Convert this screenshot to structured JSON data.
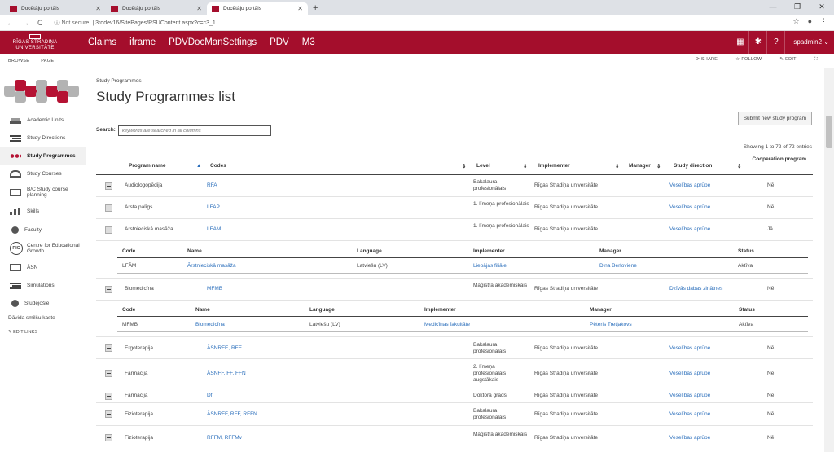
{
  "browser": {
    "tabs": [
      {
        "title": "Docētāju portāls"
      },
      {
        "title": "Docētāju portāls"
      },
      {
        "title": "Docētāju portāls"
      }
    ],
    "new_tab": "+",
    "not_secure": "Not secure",
    "url": "3rodev16/SitePages/RSUContent.aspx?c=c3_1",
    "back": "←",
    "forward": "→",
    "reload": "C",
    "info": "ⓘ",
    "minimize": "—",
    "maximize": "❐",
    "close": "✕",
    "star": "☆",
    "account": "●",
    "menu": "⋮"
  },
  "suite": {
    "logo_line1": "RĪGAS STRADIŅA",
    "logo_line2": "UNIVERSITĀTE",
    "nav": [
      "Claims",
      "iframe",
      "PDVDocManSettings",
      "PDV",
      "M3"
    ],
    "apps_icon": "▦",
    "settings_icon": "✱",
    "help_icon": "?",
    "user": "spadmin2 ⌄"
  },
  "ribbon": {
    "browse": "BROWSE",
    "page": "PAGE",
    "share": "⟳ SHARE",
    "follow": "☆ FOLLOW",
    "edit": "✎ EDIT",
    "focus": "⛶"
  },
  "sidebar": {
    "items": [
      {
        "label": "Academic Units",
        "icon": "a"
      },
      {
        "label": "Study Directions",
        "icon": "b"
      },
      {
        "label": "Study Programmes",
        "icon": "c"
      },
      {
        "label": "Study Courses",
        "icon": "d"
      },
      {
        "label": "B/C Study course planning",
        "icon": "e"
      },
      {
        "label": "Skills",
        "icon": "f"
      },
      {
        "label": "Faculty",
        "icon": "g"
      },
      {
        "label": "Centre for Educational Growth",
        "icon": "pic",
        "pic_text": "PIC"
      },
      {
        "label": "ĀSN",
        "icon": "e"
      },
      {
        "label": "Simulations",
        "icon": "b"
      },
      {
        "label": "Studējošie",
        "icon": "g"
      }
    ],
    "sandbox": "Dāvida smilšu kaste",
    "edit_links": "✎ EDIT LINKS"
  },
  "main": {
    "breadcrumb": "Study Programmes",
    "title": "Study Programmes list",
    "submit_button": "Submit new study program",
    "search_label": "Search:",
    "search_placeholder": "keywords are searched in all columns",
    "showing": "Showing 1 to 72 of 72 entries",
    "columns": {
      "name": "Program name",
      "codes": "Codes",
      "level": "Level",
      "implementer": "Implementer",
      "manager": "Manager",
      "direction": "Study direction",
      "coop": "Cooperation program"
    },
    "sub_columns": {
      "code": "Code",
      "name": "Name",
      "language": "Language",
      "implementer": "Implementer",
      "manager": "Manager",
      "status": "Status"
    }
  },
  "rows": [
    {
      "name": "Audiologopēdija",
      "codes": "RFA",
      "level": "Bakalaura profesionālais",
      "implementer": "Rīgas Stradiņa universitāte",
      "direction": "Veselības aprūpe",
      "coop": "Nē"
    },
    {
      "name": "Ārsta palīgs",
      "codes": "LFAP",
      "level": "1. līmeņa profesionālais",
      "implementer": "Rīgas Stradiņa universitāte",
      "direction": "Veselības aprūpe",
      "coop": "Nē"
    },
    {
      "name": "Ārstnieciskā masāža",
      "codes": "LFĀM",
      "level": "1. līmeņa profesionālais",
      "implementer": "Rīgas Stradiņa universitāte",
      "direction": "Veselības aprūpe",
      "coop": "Jā"
    },
    {
      "name": "Biomedicīna",
      "codes": "MFMB",
      "level": "Maģistra akadēmiskais",
      "implementer": "Rīgas Stradiņa universitāte",
      "direction": "Dzīvās dabas zinātnes",
      "coop": "Nē"
    },
    {
      "name": "Ergoterapija",
      "codes": "ĀSNRFE, RFE",
      "level": "Bakalaura profesionālais",
      "implementer": "Rīgas Stradiņa universitāte",
      "direction": "Veselības aprūpe",
      "coop": "Nē"
    },
    {
      "name": "Farmācija",
      "codes": "ĀSNFF, FF, FFN",
      "level": "2. līmeņa profesionālais augstākais",
      "implementer": "Rīgas Stradiņa universitāte",
      "direction": "Veselības aprūpe",
      "coop": "Nē"
    },
    {
      "name": "Farmācija",
      "codes": "Df",
      "level": "Doktora grāds",
      "implementer": "Rīgas Stradiņa universitāte",
      "direction": "Veselības aprūpe",
      "coop": "Nē"
    },
    {
      "name": "Fizioterapija",
      "codes": "ĀSNRFF, RFF, RFFN",
      "level": "Bakalaura profesionālais",
      "implementer": "Rīgas Stradiņa universitāte",
      "direction": "Veselības aprūpe",
      "coop": "Nē"
    },
    {
      "name": "Fizioterapija",
      "codes": "RFFM, RFFMv",
      "level": "Maģistra akadēmiskais",
      "implementer": "Rīgas Stradiņa universitāte",
      "direction": "Veselības aprūpe",
      "coop": "Nē"
    }
  ],
  "subrows": [
    {
      "code": "LFĀM",
      "name": "Ārstnieciskā masāža",
      "language": "Latviešu (LV)",
      "implementer": "Liepājas filiāle",
      "manager": "Dina Berloviene",
      "status": "Aktīva"
    },
    {
      "code": "MFMB",
      "name": "Biomedicīna",
      "language": "Latviešu (LV)",
      "implementer": "Medicīnas fakultāte",
      "manager": "Pēteris Tretjakovs",
      "status": "Aktīva"
    }
  ]
}
